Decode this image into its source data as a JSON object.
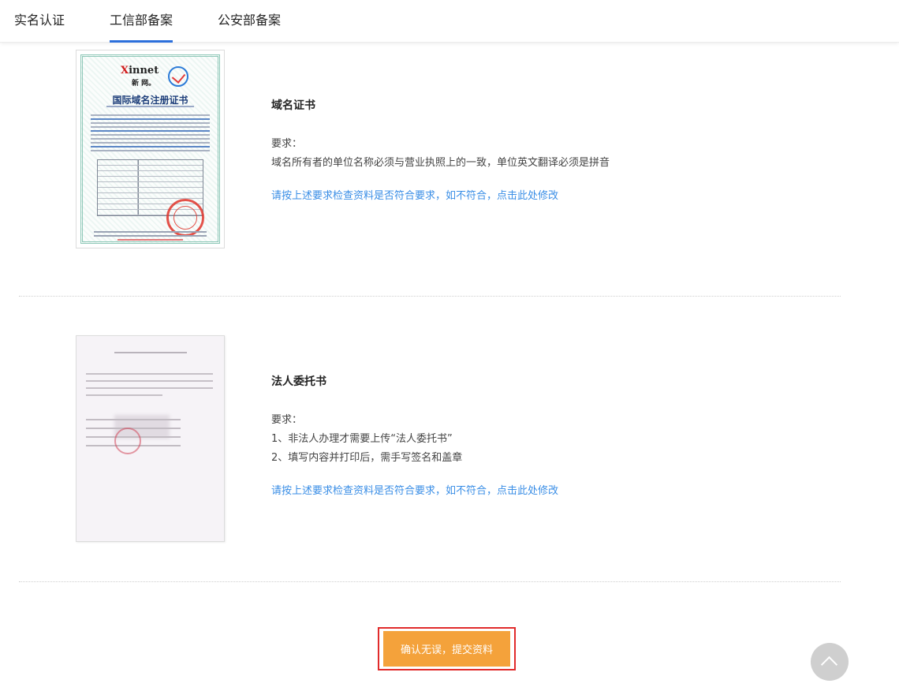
{
  "tabs": [
    {
      "label": "实名认证",
      "active": false
    },
    {
      "label": "工信部备案",
      "active": true
    },
    {
      "label": "公安部备案",
      "active": false
    }
  ],
  "sections": [
    {
      "title": "域名证书",
      "requirement_label": "要求：",
      "requirements": [
        "域名所有者的单位名称必须与营业执照上的一致，单位英文翻译必须是拼音"
      ],
      "link": "请按上述要求检查资料是否符合要求，如不符合，点击此处修改",
      "thumbnail": {
        "logo": "innet",
        "logo_x": "X",
        "logo_sub": "新 网。",
        "title": "国际域名注册证书"
      }
    },
    {
      "title": "法人委托书",
      "requirement_label": "要求：",
      "requirements": [
        "1、非法人办理才需要上传“法人委托书”",
        "2、填写内容并打印后，需手写签名和盖章"
      ],
      "link": "请按上述要求检查资料是否符合要求，如不符合，点击此处修改"
    }
  ],
  "submit_button": {
    "label": "确认无误，提交资料"
  },
  "colors": {
    "accent": "#2c6fdb",
    "link": "#3a8ee6",
    "submit": "#f4a23b",
    "highlight": "#e12b2b"
  },
  "icons": {
    "back_to_top": "chevron-up-icon"
  }
}
